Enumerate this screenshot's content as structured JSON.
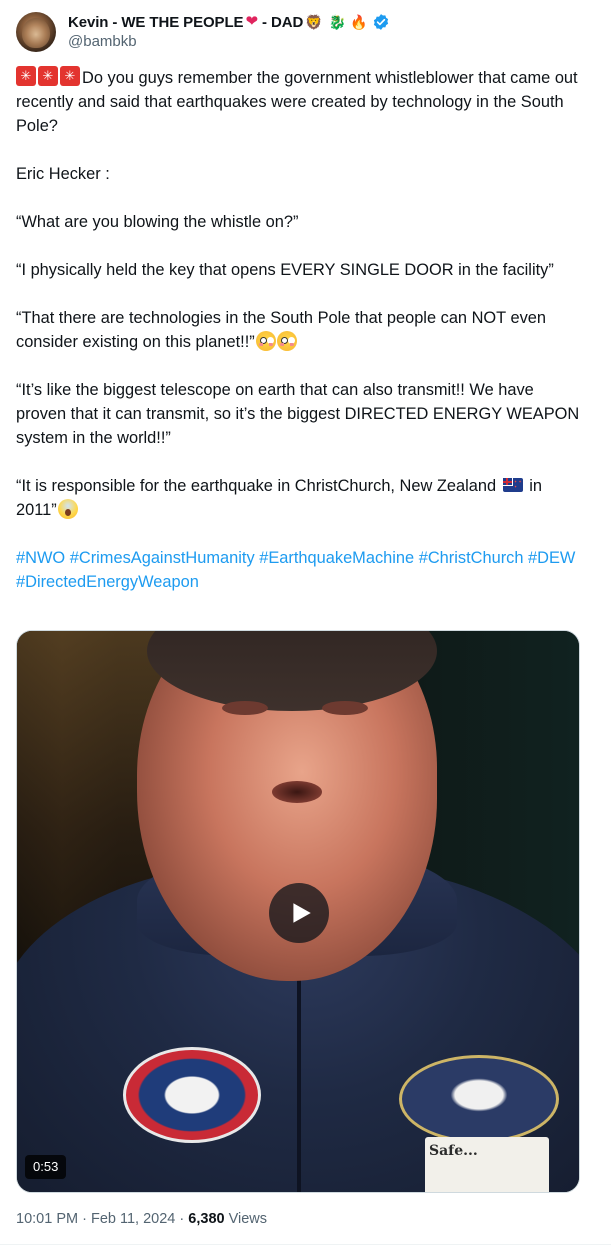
{
  "author": {
    "display_name": "Kevin - WE THE PEOPLE",
    "name_suffix": "- DAD",
    "handle": "@bambkb",
    "verified": true,
    "badge_color": "#1d9bf0",
    "name_emoji_icons": [
      "red-heart-icon",
      "lion-face-icon",
      "dragon-icon",
      "fire-icon",
      "verified-badge-icon"
    ]
  },
  "tweet": {
    "intro_icons": [
      "police-light-icon",
      "police-light-icon",
      "police-light-icon"
    ],
    "p1": "Do you guys remember the government whistleblower that came out recently and said that earthquakes were created by technology in the South Pole?",
    "p2": "Eric Hecker :",
    "p3": "“What are you blowing the whistle on?”",
    "p4": "“I physically held the key that opens EVERY SINGLE DOOR in the facility”",
    "p5": "“That there are technologies in the South Pole that people can NOT even consider existing on this planet!!”",
    "p6": "“It’s like the biggest telescope on earth that can also transmit!! We have proven that it can transmit, so it’s the biggest DIRECTED ENERGY WEAPON system in the world!!”",
    "p7_start": "“It is responsible for the earthquake in ChristChurch, New Zealand",
    "p7_in": "in",
    "p7_end": "2011”",
    "hashtags": [
      "#NWO",
      "#CrimesAgainstHumanity",
      "#EarthquakeMachine",
      "#ChristChurch",
      "#DEW",
      "#DirectedEnergyWeapon"
    ],
    "link_color": "#1d9bf0"
  },
  "media": {
    "type": "video",
    "duration": "0:53",
    "name_tag_text": "Safe..."
  },
  "meta": {
    "time": "10:01 PM",
    "separator": "·",
    "date": "Feb 11, 2024",
    "views_count": "6,380",
    "views_label": "Views"
  }
}
